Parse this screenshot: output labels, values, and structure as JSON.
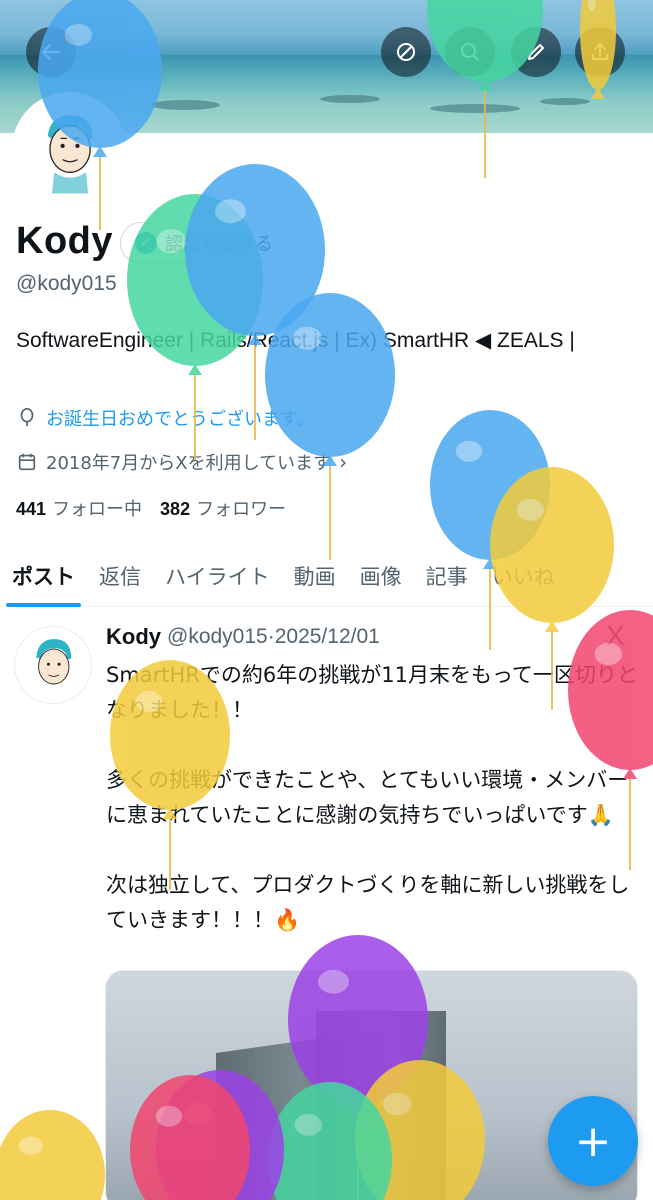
{
  "header": {
    "back_icon": "arrow-left-icon",
    "actions": [
      "translate-icon",
      "search-icon",
      "edit-icon",
      "share-icon"
    ]
  },
  "profile": {
    "name": "Kody",
    "verify_label": "認証を受ける",
    "handle": "@kody015",
    "bio": "SoftwareEngineer | Rails/React.js | Ex) SmartHR ◀ ZEALS |",
    "birthday_text": "お誕生日おめでとうございます。",
    "joined_text": "2018年7月からXを利用しています",
    "following_count": "441",
    "following_label": "フォロー中",
    "followers_count": "382",
    "followers_label": "フォロワー"
  },
  "tabs": [
    {
      "label": "ポスト",
      "active": true
    },
    {
      "label": "返信",
      "active": false
    },
    {
      "label": "ハイライト",
      "active": false
    },
    {
      "label": "動画",
      "active": false
    },
    {
      "label": "画像",
      "active": false
    },
    {
      "label": "記事",
      "active": false
    },
    {
      "label": "いいね",
      "active": false
    }
  ],
  "post": {
    "name": "Kody",
    "meta": "@kody015·2025/12/01",
    "close": "X",
    "text": "SmartHRでの約6年の挑戦が11月末をもって一区切りとなりました！！\n\n多くの挑戦ができたことや、とてもいい環境・メンバーに恵まれていたことに感謝の気持ちでいっぱいです🙏\n\n次は独立して、プロダクトづくりを軸に新しい挑戦をしていきます！！！🔥"
  },
  "fab": {
    "label": "+"
  },
  "colors": {
    "accent": "#1d9bf0",
    "text": "#0f1419",
    "muted": "#536471",
    "balloon_blue": "#4aa8f0",
    "balloon_green": "#46d6a0",
    "balloon_yellow": "#f3cb3a",
    "balloon_red": "#f2456e",
    "balloon_purple": "#9b42e6"
  }
}
